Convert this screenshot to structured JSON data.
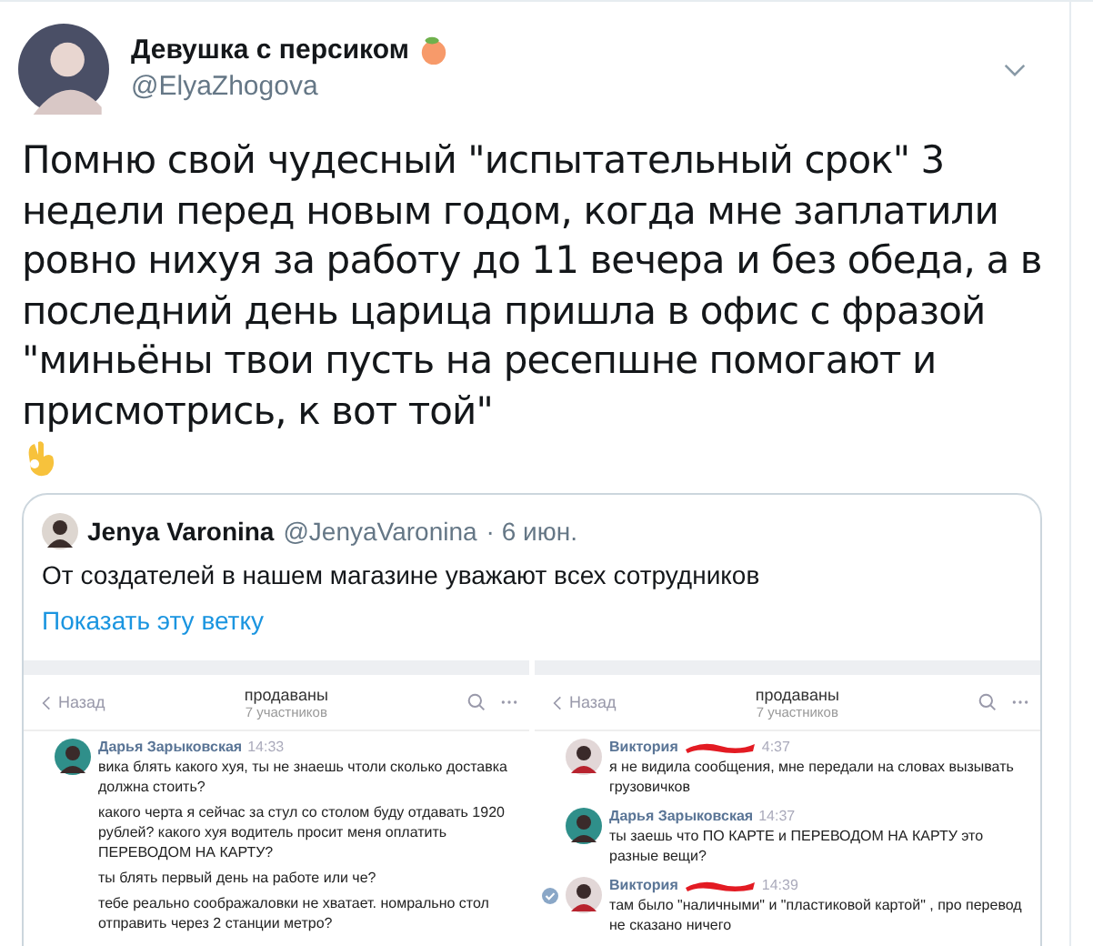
{
  "author": {
    "name": "Девушка с персиком",
    "handle": "@ElyaZhogova"
  },
  "text": "Помню свой чудесный \"испытательный срок\" 3 недели перед новым годом, когда мне заплатили ровно нихуя за работу до 11 вечера и без обеда, а в последний день царица пришла в офис с фразой \"миньёны твои пусть на ресепшне помогают и присмотрись, к вот той\"",
  "quote": {
    "name": "Jenya Varonina",
    "handle": "@JenyaVaronina",
    "date": "· 6 июн.",
    "text": "От создателей в нашем магазине уважают всех сотрудников",
    "link": "Показать эту ветку",
    "chats": [
      {
        "back": "Назад",
        "title": "продаваны",
        "subtitle": "7 участников",
        "messages": [
          {
            "author": "Дарья Зарыковская",
            "time": "14:33",
            "redacted": false,
            "selected": false,
            "paragraphs": [
              "вика блять какого хуя, ты не знаешь чтоли сколько доставка должна стоить?",
              "какого черта я сейчас за стул со столом буду отдавать 1920 рублей? какого хуя водитель просит меня оплатить ПЕРЕВОДОМ НА КАРТУ?",
              "ты блять первый день на работе или че?",
              "тебе реально соображаловки не хватает. номрально стол отправить через 2 станции метро?"
            ]
          }
        ]
      },
      {
        "back": "Назад",
        "title": "продаваны",
        "subtitle": "7 участников",
        "messages": [
          {
            "author": "Виктория",
            "time": "4:37",
            "redacted": true,
            "selected": false,
            "paragraphs": [
              "я не видила сообщения, мне передали на словах вызывать грузовичков"
            ]
          },
          {
            "author": "Дарья Зарыковская",
            "time": "14:37",
            "redacted": false,
            "selected": false,
            "paragraphs": [
              "ты заешь что ПО КАРТЕ и ПЕРЕВОДОМ НА КАРТУ это разные вещи?"
            ]
          },
          {
            "author": "Виктория",
            "time": "14:39",
            "redacted": true,
            "selected": true,
            "paragraphs": [
              "там было \"наличными\" и \"пластиковой картой\" , про перевод не сказано ничего"
            ]
          }
        ]
      }
    ]
  }
}
